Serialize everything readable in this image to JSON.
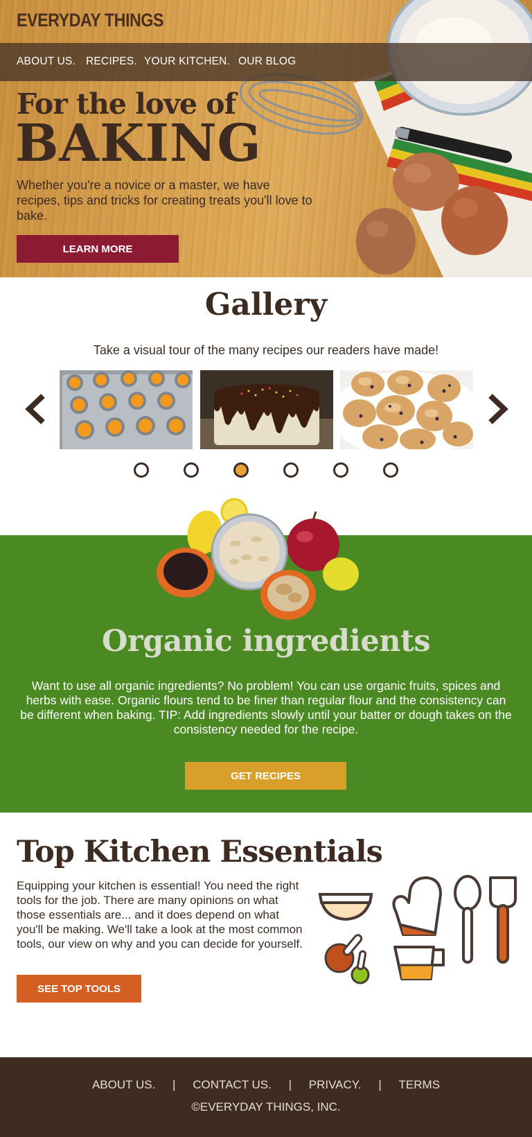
{
  "brand": {
    "name": "EVERYDAY THINGS"
  },
  "nav": {
    "items": [
      "ABOUT US.",
      "RECIPES.",
      "YOUR KITCHEN.",
      "OUR BLOG"
    ]
  },
  "hero": {
    "title_line1": "For the love of",
    "title_line2": "BAKING",
    "text": "Whether you're a novice or a master, we have recipes, tips and tricks for creating treats you'll love to bake.",
    "button": "LEARN MORE"
  },
  "gallery": {
    "title": "Gallery",
    "subtitle": "Take a visual tour of the many recipes our readers have made!",
    "thumbnails": [
      "muffin-tin-photo",
      "chocolate-drip-cake-photo",
      "blueberry-scones-photo"
    ],
    "dots_total": 6,
    "active_dot": 3
  },
  "organic": {
    "title": "Organic ingredients",
    "text": "Want to use all organic ingredients? No problem! You can use organic fruits, spices and herbs with ease. Organic flours tend to be finer than regular flour and the consistency can be different when baking. TIP: Add ingredients slowly until your batter or dough takes on the consistency needed for the recipe.",
    "button": "GET RECIPES"
  },
  "essentials": {
    "title": "Top Kitchen Essentials",
    "text": "Equipping your kitchen is essential! You need the right tools for the job. There are many opinions on what those essentials are... and it does depend on what you'll be making. We'll take a look at the most common tools, our view on why and you can decide for yourself.",
    "button": "SEE TOP TOOLS"
  },
  "footer": {
    "links": [
      "ABOUT US.",
      "CONTACT US.",
      "PRIVACY.",
      "TERMS"
    ],
    "separator": "|",
    "copyright": "©EVERYDAY THINGS, INC."
  },
  "colors": {
    "dark_brown": "#3d2b22",
    "learn_button": "#8d1a33",
    "organic_bg": "#4b8a22",
    "recipes_button": "#d8a02a",
    "tools_button": "#d55f22",
    "footer_bg": "#3e2b22",
    "active_dot": "#e8a13a"
  },
  "icons": [
    "chevron-left-icon",
    "chevron-right-icon",
    "mixing-bowl-icon",
    "oven-mitt-icon",
    "spoon-icon",
    "spatula-icon",
    "measuring-spoons-icon",
    "measuring-cup-icon"
  ]
}
